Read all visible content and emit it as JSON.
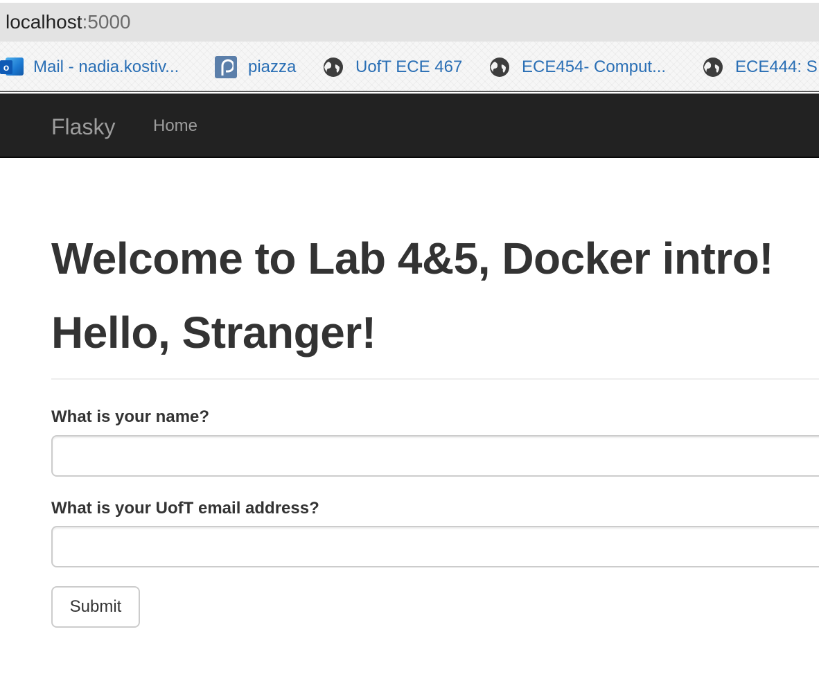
{
  "browser": {
    "url_host": "localhost",
    "url_port": ":5000",
    "bookmarks": [
      {
        "label": "Mail - nadia.kostiv...",
        "icon": "outlook-icon"
      },
      {
        "label": "piazza",
        "icon": "piazza-icon"
      },
      {
        "label": "UofT ECE 467",
        "icon": "globe-icon"
      },
      {
        "label": "ECE454- Comput...",
        "icon": "globe-icon"
      },
      {
        "label": "ECE444: S",
        "icon": "globe-icon"
      }
    ]
  },
  "navbar": {
    "brand": "Flasky",
    "links": [
      {
        "label": "Home"
      }
    ]
  },
  "page": {
    "welcome": "Welcome to Lab 4&5, Docker intro!",
    "greeting": "Hello, Stranger!"
  },
  "form": {
    "name_label": "What is your name?",
    "name_value": "",
    "email_label": "What is your UofT email address?",
    "email_value": "",
    "submit_label": "Submit"
  },
  "colors": {
    "navbar_bg": "#222222",
    "nav_text": "#9d9d9d",
    "bookmark_link": "#2a6fb5",
    "text": "#333333"
  }
}
